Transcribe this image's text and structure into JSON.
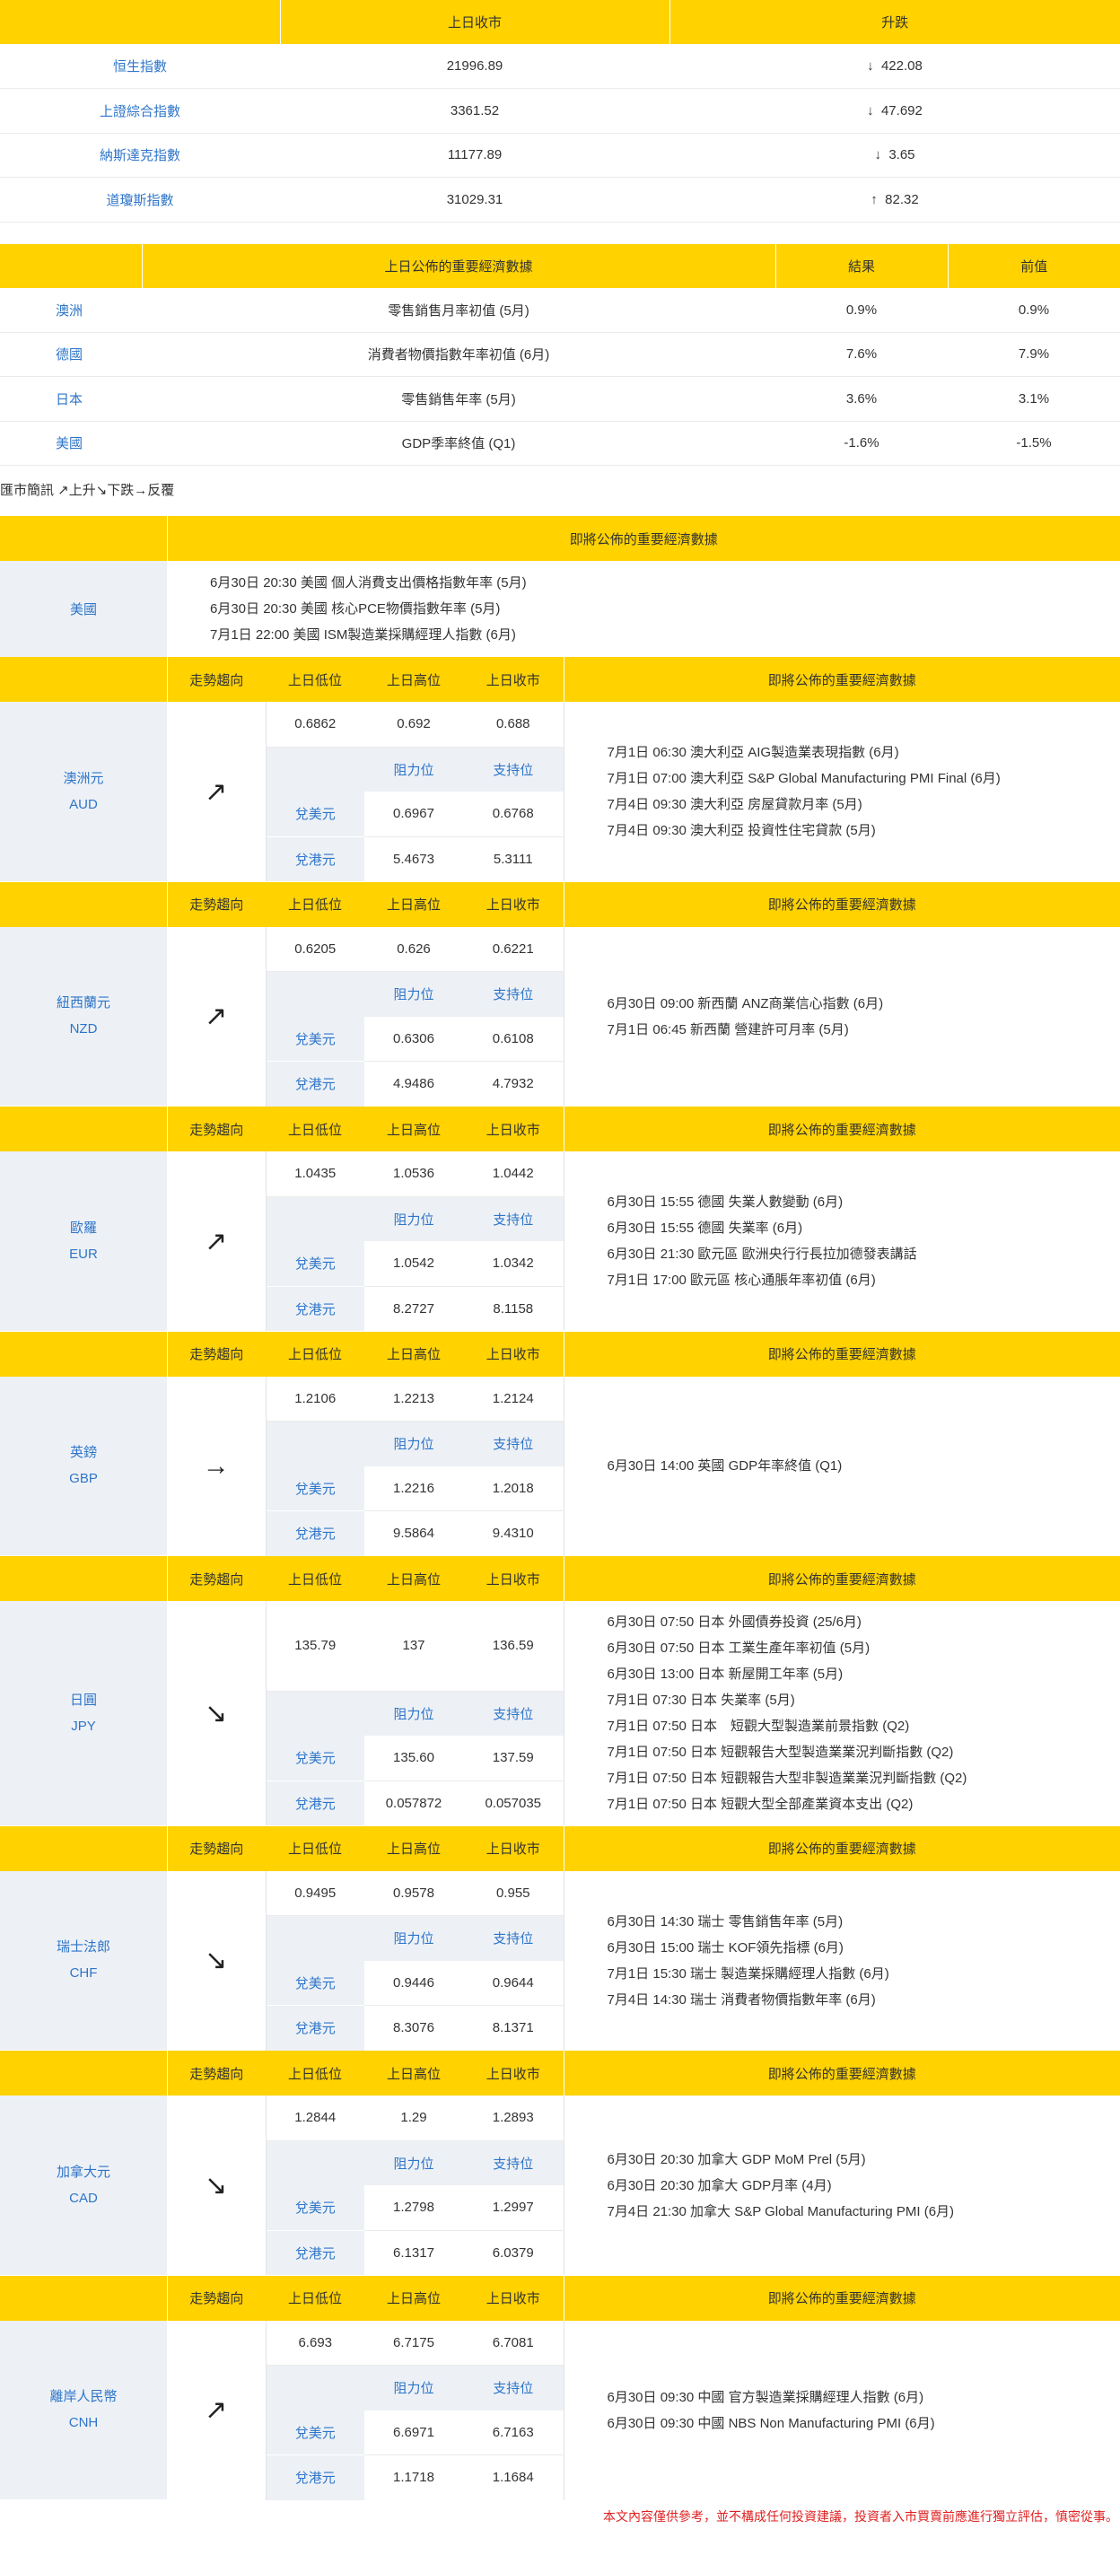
{
  "index_table": {
    "headers": [
      "",
      "上日收市",
      "升跌"
    ],
    "rows": [
      {
        "name": "恒生指數",
        "close": "21996.89",
        "dir": "↓",
        "change": "422.08"
      },
      {
        "name": "上證綜合指數",
        "close": "3361.52",
        "dir": "↓",
        "change": "47.692"
      },
      {
        "name": "納斯達克指數",
        "close": "11177.89",
        "dir": "↓",
        "change": "3.65"
      },
      {
        "name": "道瓊斯指數",
        "close": "31029.31",
        "dir": "↑",
        "change": "82.32"
      }
    ]
  },
  "econ_table": {
    "headers": [
      "",
      "上日公佈的重要經濟數據",
      "結果",
      "前值"
    ],
    "rows": [
      {
        "country": "澳洲",
        "item": "零售銷售月率初值 (5月)",
        "result": "0.9%",
        "previous": "0.9%"
      },
      {
        "country": "德國",
        "item": "消費者物價指數年率初值 (6月)",
        "result": "7.6%",
        "previous": "7.9%"
      },
      {
        "country": "日本",
        "item": "零售銷售年率 (5月)",
        "result": "3.6%",
        "previous": "3.1%"
      },
      {
        "country": "美國",
        "item": "GDP季率終值 (Q1)",
        "result": "-1.6%",
        "previous": "-1.5%"
      }
    ]
  },
  "fx_legend": "匯市簡訊 ↗上升↘下跌→反覆",
  "us_section": {
    "header": "即將公佈的重要經濟數據",
    "country": "美國",
    "events": [
      "6月30日 20:30 美國 個人消費支出價格指數年率 (5月)",
      "6月30日 20:30 美國 核心PCE物價指數年率 (5月)",
      "7月1日 22:00 美國 ISM製造業採購經理人指數 (6月)"
    ]
  },
  "fx_headers": {
    "trend": "走勢趨向",
    "low": "上日低位",
    "high": "上日高位",
    "close": "上日收市",
    "events": "即將公佈的重要經濟數據",
    "resistance": "阻力位",
    "support": "支持位",
    "vs_usd": "兌美元",
    "vs_hkd": "兌港元"
  },
  "currencies": [
    {
      "name": "澳洲元",
      "code": "AUD",
      "trend": "↗",
      "low": "0.6862",
      "high": "0.692",
      "close": "0.688",
      "usd_res": "0.6967",
      "usd_sup": "0.6768",
      "hkd_res": "5.4673",
      "hkd_sup": "5.3111",
      "events": [
        "7月1日 06:30 澳大利亞 AIG製造業表現指數 (6月)",
        "7月1日 07:00 澳大利亞 S&P Global Manufacturing PMI Final (6月)",
        "7月4日 09:30 澳大利亞 房屋貸款月率 (5月)",
        "7月4日 09:30 澳大利亞 投資性住宅貸款 (5月)"
      ]
    },
    {
      "name": "紐西蘭元",
      "code": "NZD",
      "trend": "↗",
      "low": "0.6205",
      "high": "0.626",
      "close": "0.6221",
      "usd_res": "0.6306",
      "usd_sup": "0.6108",
      "hkd_res": "4.9486",
      "hkd_sup": "4.7932",
      "events": [
        "6月30日 09:00 新西蘭 ANZ商業信心指數 (6月)",
        "7月1日 06:45 新西蘭 營建許可月率 (5月)"
      ]
    },
    {
      "name": "歐羅",
      "code": "EUR",
      "trend": "↗",
      "low": "1.0435",
      "high": "1.0536",
      "close": "1.0442",
      "usd_res": "1.0542",
      "usd_sup": "1.0342",
      "hkd_res": "8.2727",
      "hkd_sup": "8.1158",
      "events": [
        "6月30日 15:55 德國 失業人數變動 (6月)",
        "6月30日 15:55 德國 失業率 (6月)",
        "6月30日 21:30 歐元區 歐洲央行行長拉加德發表講話",
        "7月1日 17:00 歐元區 核心通脹年率初值 (6月)"
      ]
    },
    {
      "name": "英鎊",
      "code": "GBP",
      "trend": "→",
      "low": "1.2106",
      "high": "1.2213",
      "close": "1.2124",
      "usd_res": "1.2216",
      "usd_sup": "1.2018",
      "hkd_res": "9.5864",
      "hkd_sup": "9.4310",
      "events": [
        "6月30日 14:00 英國 GDP年率終值 (Q1)"
      ]
    },
    {
      "name": "日圓",
      "code": "JPY",
      "trend": "↘",
      "low": "135.79",
      "high": "137",
      "close": "136.59",
      "usd_res": "135.60",
      "usd_sup": "137.59",
      "hkd_res": "0.057872",
      "hkd_sup": "0.057035",
      "events": [
        "6月30日 07:50 日本 外國債券投資 (25/6月)",
        "6月30日 07:50 日本 工業生產年率初值 (5月)",
        "6月30日 13:00 日本 新屋開工年率 (5月)",
        "7月1日 07:30 日本 失業率 (5月)",
        "7月1日 07:50 日本　短觀大型製造業前景指數 (Q2)",
        "7月1日 07:50 日本 短觀報告大型製造業業況判斷指數 (Q2)",
        "7月1日 07:50 日本 短觀報告大型非製造業業況判斷指數 (Q2)",
        "7月1日 07:50 日本 短觀大型全部產業資本支出 (Q2)"
      ]
    },
    {
      "name": "瑞士法郎",
      "code": "CHF",
      "trend": "↘",
      "low": "0.9495",
      "high": "0.9578",
      "close": "0.955",
      "usd_res": "0.9446",
      "usd_sup": "0.9644",
      "hkd_res": "8.3076",
      "hkd_sup": "8.1371",
      "events": [
        "6月30日 14:30 瑞士 零售銷售年率 (5月)",
        "6月30日 15:00 瑞士 KOF領先指標 (6月)",
        "7月1日 15:30 瑞士 製造業採購經理人指數 (6月)",
        "7月4日 14:30 瑞士 消費者物價指數年率 (6月)"
      ]
    },
    {
      "name": "加拿大元",
      "code": "CAD",
      "trend": "↘",
      "low": "1.2844",
      "high": "1.29",
      "close": "1.2893",
      "usd_res": "1.2798",
      "usd_sup": "1.2997",
      "hkd_res": "6.1317",
      "hkd_sup": "6.0379",
      "events": [
        "6月30日 20:30 加拿大 GDP MoM Prel (5月)",
        "6月30日 20:30 加拿大 GDP月率 (4月)",
        "7月4日 21:30 加拿大 S&P Global Manufacturing PMI (6月)"
      ]
    },
    {
      "name": "離岸人民幣",
      "code": "CNH",
      "trend": "↗",
      "low": "6.693",
      "high": "6.7175",
      "close": "6.7081",
      "usd_res": "6.6971",
      "usd_sup": "6.7163",
      "hkd_res": "1.1718",
      "hkd_sup": "1.1684",
      "events": [
        "6月30日 09:30 中國 官方製造業採購經理人指數 (6月)",
        "6月30日 09:30 中國 NBS Non Manufacturing PMI (6月)"
      ]
    }
  ],
  "disclaimer": "本文內容僅供參考，並不構成任何投資建議，投資者入市買賣前應進行獨立評估，慎密從事。"
}
